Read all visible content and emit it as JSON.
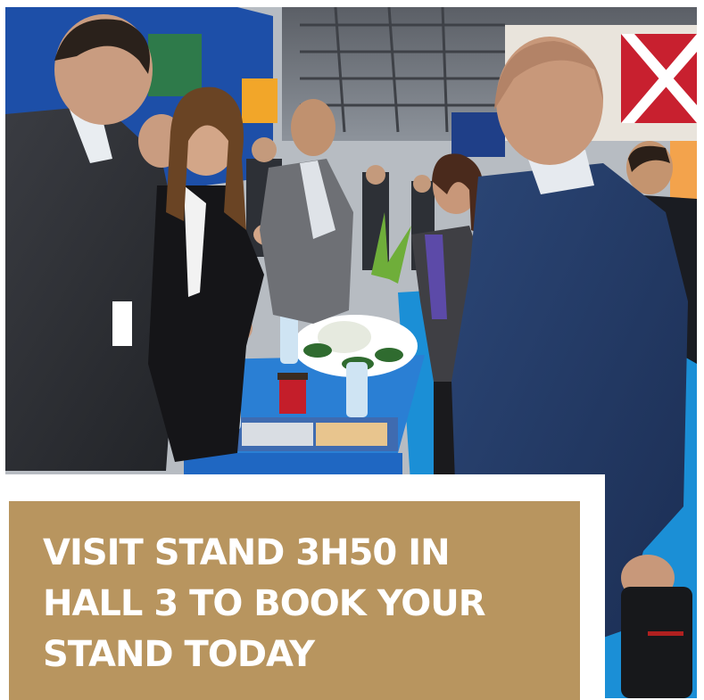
{
  "caption": {
    "line_1": "VISIT STAND 3H50 IN",
    "line_2": "HALL 3 TO BOOK YOUR",
    "line_3": "STAND TODAY"
  },
  "colors": {
    "caption_background": "#b8955f",
    "caption_text": "#ffffff",
    "frame": "#ffffff",
    "carpet_blue": "#1b8fd6"
  },
  "photo": {
    "subject": "exhibition-stand-crowd"
  }
}
